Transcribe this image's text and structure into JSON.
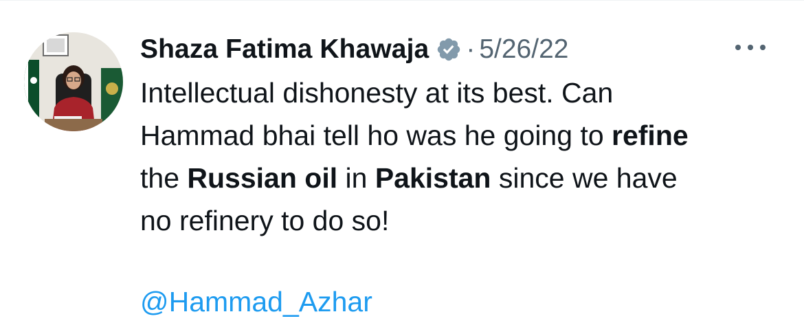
{
  "tweet": {
    "author": {
      "display_name": "Shaza Fatima Khawaja",
      "verified_icon": "verified-badge-icon",
      "verified_color": "#829aab"
    },
    "separator": "·",
    "date": "5/26/22",
    "more_icon": "more-options-icon",
    "text": {
      "l1": "Intellectual dishonesty at its best. Can",
      "l2a": "Hammad bhai tell ho was he going to ",
      "l2b": "refine",
      "l3a": "the ",
      "l3b": "Russian oil",
      "l3c": " in ",
      "l3d": "Pakistan",
      "l3e": " since we have",
      "l4": "no refinery to do so!"
    },
    "mention": "@Hammad_Azhar"
  },
  "colors": {
    "text": "#0f1419",
    "secondary": "#536471",
    "link": "#1d9bf0"
  }
}
